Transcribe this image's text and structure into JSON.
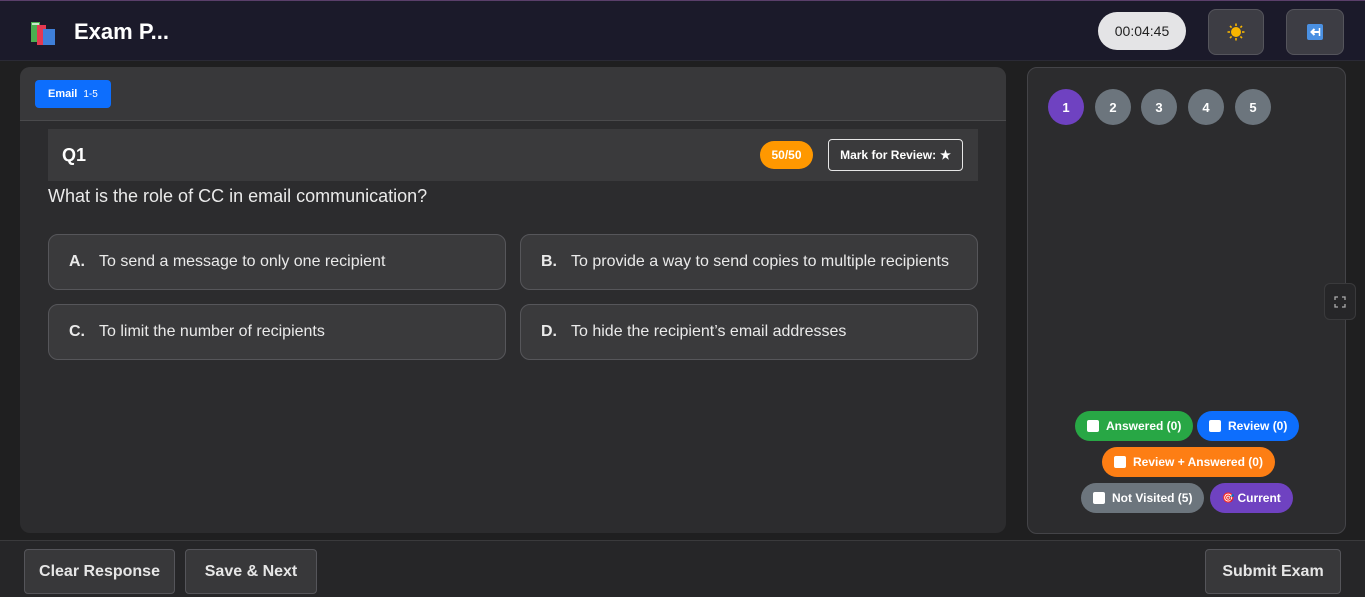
{
  "header": {
    "title": "Exam P...",
    "timer": "00:04:45",
    "theme_icon": "sun-icon",
    "exit_icon": "exit-arrow-icon"
  },
  "section": {
    "name": "Email",
    "range": "1-5"
  },
  "question": {
    "number": "Q1",
    "marks": "50/50",
    "review_label": "Mark for Review:",
    "review_icon": "★",
    "text": "What is the role of CC in email communication?",
    "options": [
      {
        "letter": "A.",
        "text": "To send a message to only one recipient"
      },
      {
        "letter": "B.",
        "text": "To provide a way to send copies to multiple recipients"
      },
      {
        "letter": "C.",
        "text": "To limit the number of recipients"
      },
      {
        "letter": "D.",
        "text": "To hide the recipient’s email addresses"
      }
    ]
  },
  "palette": {
    "questions": [
      "1",
      "2",
      "3",
      "4",
      "5"
    ],
    "current": "1",
    "legend": {
      "answered": "Answered (0)",
      "review": "Review (0)",
      "review_answered": "Review + Answered (0)",
      "not_visited": "Not Visited (5)",
      "current": "Current",
      "current_icon": "🎯"
    }
  },
  "footer": {
    "clear": "Clear Response",
    "save": "Save & Next",
    "submit": "Submit Exam"
  },
  "colors": {
    "accent_blue": "#0d6efd",
    "current_purple": "#6f42c1",
    "answered_green": "#28a745",
    "review_answered_orange": "#fd7e14",
    "marks_orange": "#ff9800",
    "not_visited_gray": "#6c757d"
  }
}
